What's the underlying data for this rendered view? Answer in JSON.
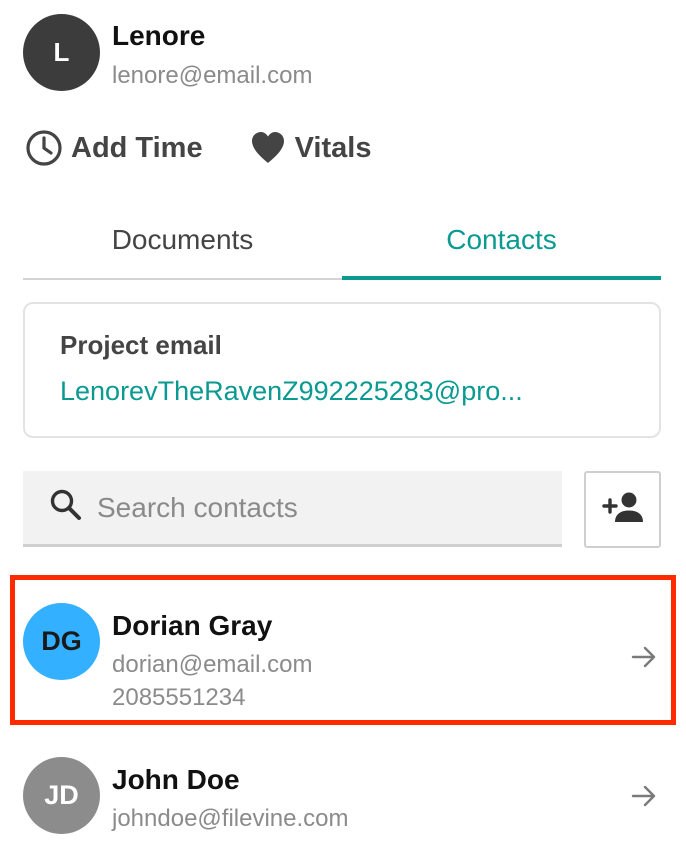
{
  "user": {
    "initial": "L",
    "name": "Lenore",
    "email": "lenore@email.com"
  },
  "actions": {
    "add_time": {
      "label": "Add Time",
      "icon": "clock-icon"
    },
    "vitals": {
      "label": "Vitals",
      "icon": "heart-icon"
    }
  },
  "tabs": [
    {
      "label": "Documents",
      "active": false
    },
    {
      "label": "Contacts",
      "active": true
    }
  ],
  "project": {
    "title": "Project email",
    "email": "LenorevTheRavenZ992225283@pro..."
  },
  "search": {
    "placeholder": "Search contacts",
    "value": ""
  },
  "add_contact": {
    "icon": "add-person-icon"
  },
  "contacts": [
    {
      "initials": "DG",
      "name": "Dorian Gray",
      "email": "dorian@email.com",
      "phone": "2085551234",
      "avatar_color": "#33b0ff",
      "initials_color": "#1a1a1a",
      "highlighted": true
    },
    {
      "initials": "JD",
      "name": "John Doe",
      "email": "johndoe@filevine.com",
      "avatar_color": "#8c8c8c",
      "initials_color": "#ffffff",
      "highlighted": false
    }
  ],
  "colors": {
    "accent": "#0a9a92",
    "highlight": "#ff2a00"
  }
}
